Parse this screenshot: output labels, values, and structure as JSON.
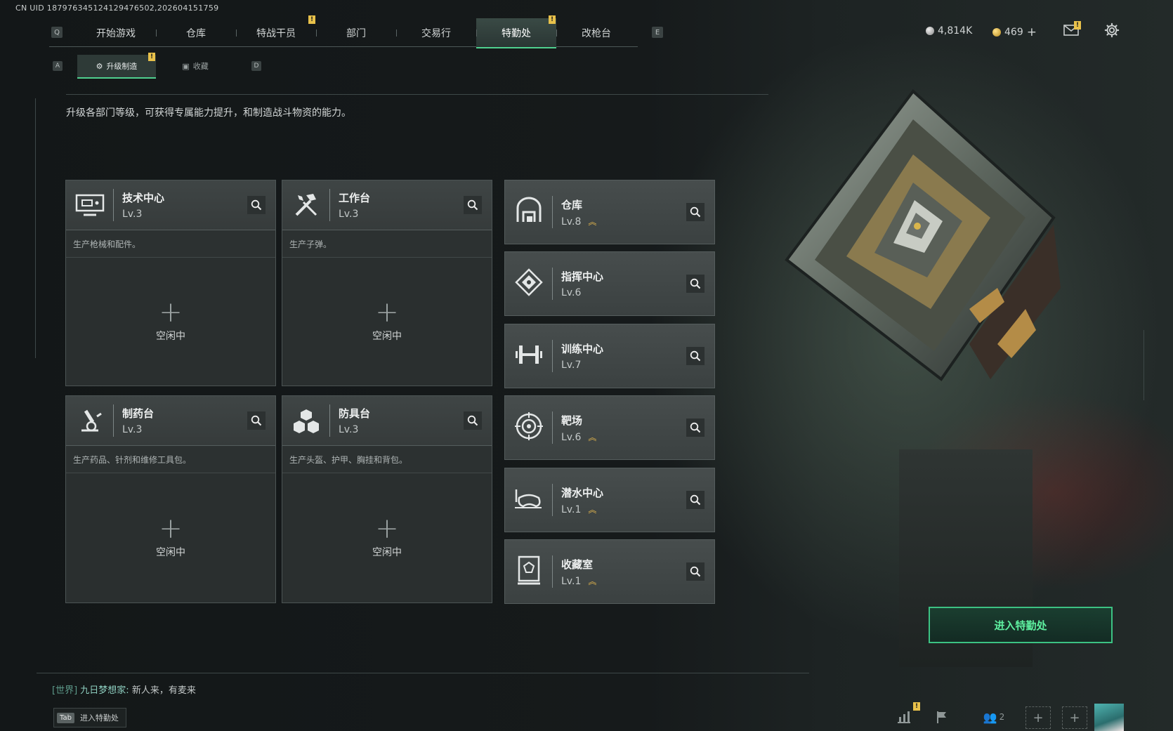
{
  "uid": "CN UID 187976345124129476502,202604151759",
  "topbar": {
    "left_key": "Q",
    "right_key": "E",
    "tabs": [
      "开始游戏",
      "仓库",
      "特战干员",
      "部门",
      "交易行",
      "特勤处",
      "改枪台"
    ],
    "active_tab": "特勤处",
    "badge": "!"
  },
  "currency": {
    "silver": "4,814K",
    "gold": "469",
    "gold_add": "+"
  },
  "subtabs": {
    "left_key": "A",
    "right_key": "D",
    "items": [
      "升级制造",
      "收藏"
    ],
    "badge": "!"
  },
  "description": "升级各部门等级，可获得专属能力提升，和制造战斗物资的能力。",
  "workstations": [
    {
      "name": "技术中心",
      "level": "Lv.3",
      "desc": "生产枪械和配件。",
      "plus": "+",
      "status": "空闲中",
      "icon": "computer-icon"
    },
    {
      "name": "工作台",
      "level": "Lv.3",
      "desc": "生产子弹。",
      "plus": "+",
      "status": "空闲中",
      "icon": "tools-icon"
    },
    {
      "name": "制药台",
      "level": "Lv.3",
      "desc": "生产药品、针剂和维修工具包。",
      "plus": "+",
      "status": "空闲中",
      "icon": "microscope-icon"
    },
    {
      "name": "防具台",
      "level": "Lv.3",
      "desc": "生产头盔、护甲、胸挂和背包。",
      "plus": "+",
      "status": "空闲中",
      "icon": "armor-icon"
    }
  ],
  "departments": [
    {
      "name": "仓库",
      "level": "Lv.8",
      "upgradable": true,
      "icon": "warehouse-icon"
    },
    {
      "name": "指挥中心",
      "level": "Lv.6",
      "upgradable": false,
      "icon": "command-icon"
    },
    {
      "name": "训练中心",
      "level": "Lv.7",
      "upgradable": false,
      "icon": "dumbbell-icon"
    },
    {
      "name": "靶场",
      "level": "Lv.6",
      "upgradable": true,
      "icon": "target-icon"
    },
    {
      "name": "潜水中心",
      "level": "Lv.1",
      "upgradable": true,
      "icon": "diving-mask-icon"
    },
    {
      "name": "收藏室",
      "level": "Lv.1",
      "upgradable": true,
      "icon": "display-case-icon"
    }
  ],
  "upgrade_glyph": "︽",
  "enter_button": "进入特勤处",
  "chat": {
    "channel": "[世界]",
    "name": "九日梦想家:",
    "message": "新人来，有麦来"
  },
  "tab_hint": {
    "key": "Tab",
    "label": "进入特勤处"
  },
  "bottom": {
    "friends_count": "2",
    "add": "+"
  }
}
